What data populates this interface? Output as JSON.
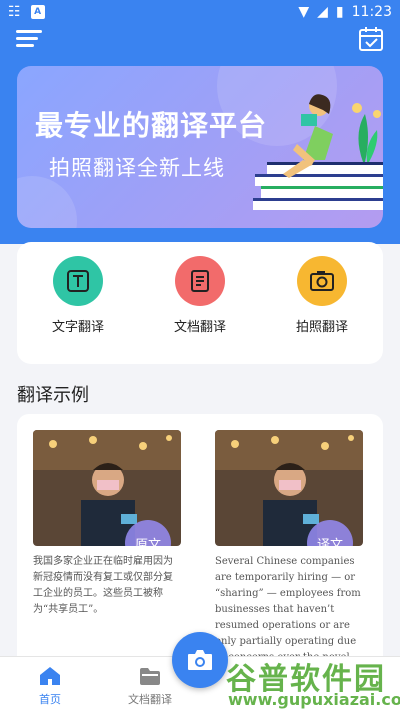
{
  "status_bar": {
    "time": "11:23",
    "icon_a": "A"
  },
  "banner": {
    "title": "最专业的翻译平台",
    "subtitle": "拍照翻译全新上线"
  },
  "functions": [
    {
      "label": "文字翻译",
      "icon": "text-icon",
      "color": "#2fc5a5"
    },
    {
      "label": "文档翻译",
      "icon": "document-icon",
      "color": "#f26b6b"
    },
    {
      "label": "拍照翻译",
      "icon": "camera-icon",
      "color": "#f7b731"
    }
  ],
  "examples_section": {
    "title": "翻译示例"
  },
  "examples": [
    {
      "tag": "原文",
      "text": "我国多家企业正在临时雇用因为新冠疫情而没有复工或仅部分复工企业的员工。这些员工被称为“共享员工”。"
    },
    {
      "tag": "译文",
      "text": "Several Chinese companies are temporarily hiring — or “sharing” — employees from businesses that haven’t resumed operations or are only partially operating due to concerns over the novel coron virus epidemic"
    }
  ],
  "bottom_nav": [
    {
      "label": "首页",
      "icon": "home-icon",
      "active": true
    },
    {
      "label": "文档翻译",
      "icon": "folder-icon",
      "active": false
    }
  ],
  "watermark": {
    "title": "谷普软件园",
    "url": "www.gupuxiazai.com"
  },
  "colors": {
    "primary": "#3a83f0"
  }
}
